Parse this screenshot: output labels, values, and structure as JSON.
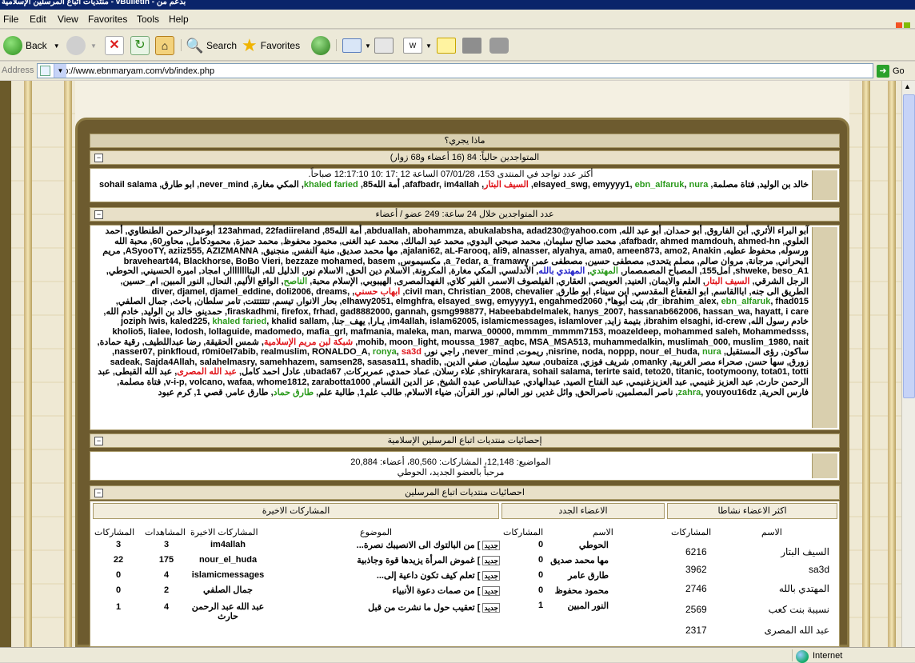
{
  "window": {
    "title": "منتديات اتباع المرسلين الإسلامية - vBulletin - بدعم من"
  },
  "menu": [
    "File",
    "Edit",
    "View",
    "Favorites",
    "Tools",
    "Help"
  ],
  "toolbar": {
    "back": "Back",
    "search": "Search",
    "favorites": "Favorites"
  },
  "address": {
    "label": "Address",
    "url": "http://www.ebnmaryam.com/vb/index.php",
    "go": "Go"
  },
  "whats_going_on": "ماذا يجري؟",
  "online": {
    "header": "المتواجدين حالياً: 84 (16 أعضاء و68 زوار)",
    "record": "أكثر عدد تواجد في المنتدى 153، 07/01/28 الساعة 12 :17 :10 12:17:10 صباحاً.",
    "users_html": "<span>خالد بن الوليد, فتاة مصلمة, elsayed_swg, </span><span>emyyyy1, </span><span class='g'>ebn_alfaruk</span>, <span class='g'>nura</span>, <span class='r'>السيف البتار</span>, afafbadr, im4allah, أمة الله85, <span class='g'>khaled faried</span>, المكي مغارة, never_mind, ابو طارق, sohail salama"
  },
  "last24": {
    "header": "عدد المتواجدين خلال 24 ساعة: 249 عضو / أعضاء",
    "users_html": "<span>آبو البراء الأثري, أبن الفاروق, أبو حمدان, أبو عبد الله, abduallah, abohammza, abukalabsha, adad230@yahoo.com, أمة الله85, 123ahmad, 22fadiireland</span> أبوعبدالرحمن الطنطاوي, أحمد العلوي, afafbadr, ahmed mamdouh, ahmed-hn, محمد صالح سليمان, محمد صبحي البدوي, محمد عبد المالك, محمد عبد الغنى, محمود محفوظ, محمد حمزة, محمودكامل, محاور60, محبة الله ورسوله, محفوظ عطيه, ajalani62, aL-Farooq, ali9, alnasser, alyahya, ama0, ameen873, amo2, Anakin, مها محمد صديق, منية النفس, منجنيق, ASyooTY, aziiz555, AZIZMANNA, مريم البحراني, مرجانة, مروان صالم, مصلم يتحدى, مصطفى حسين, مصطفى عمر, a_7edar, a_framawy, مكسيموس, braveheart44, Blackhorse, BoBo Vieri, bezzaze mohamed, basem shweke, beso_A1, امل155, المصباح المصمصمار, <span class='g'>المهتدي</span>, <span class='b'>المهتدي بالله</span>, الأندلسي, المكي مغارة, المكرونة, الاسلام دين الحق, الاسلام نور, الذليل لله, البتاااااااار, امجاد, اميره الحسيني, الحوطي, الرجل الشرقي, <span class='r'>السيف البتار</span>, العلم والايمان, العنيد, العويصي, العقاري, الفيلصوف الاسمر, الفير كلاي, الفهدالمصرى, الهيبوبي, الإسلام محبة, <span class='g'>الناصح</span>, الواقع الأليم, النحال, النور المبين, ام_حسين, الطريق الى جنه, اباالقاسم, ابو القعقاع المقدسي, ابن سيناء, ابو طارق, civil man, Christian_2008, chevalier, <span class='r'>ابهاب حسني</span>, diver, djamel, djamel_eddine, doli2006, dreams, dr_ibrahim_alex, <span class='g'>ebn_alfaruk</span>, fhad015, بنت أبوها*, elhawy2051, elmghfra, elsayed_swg, emyyyy1, engahmed2060, بحار الانوار, تيسم, تتتتتتت, تامر سلطان, باحث, جمال الصلفي, firaskadhmi, firefox, frhad, gad8882000, gannah, gsmg998877, Habeebabdelmalek, hanys_2007, hassanab662006, hassan_wa, hayatt, i care, حمدينو, خالد بن الوليد, خادم الله, خادم رسول الله, ibrahim elsaghi, id-crew, بتيمة زايد, im4allah, islam62005, islamicmessages, islamlover, يـارا, يهف_جنا, joziph lwis, kaled225, <span class='g'>khaled faried</span>, khalid sallam, kholio5, lialee, lodosh, lollaguide, madomedo, mafia_grl, mafmania, maleka, man, marwa_00000, mmmm_mmmm7153, moazeldeep, mohammed saleh, Mohammedsss, mohib, moon_light, moussa_1987_aqbc, MSA_MSA513, muhammedalkin, muslimah_000, muslim_1980, nait, <span class='r'>شبكة لبن مريم الإسلامية</span>, شمس الحقيقة, رضا عبداللطيف, رقية حمادة, ساكون, رؤى المستقبل, nisrine, noda, noppp, nour_el_huda, <span class='g'>nura</span>, ريموت, never_mind, راجي نور, nasser07, pinkfloud, r0mi0el7abib, realmuslim, RONALDO_A, <span class='g'>ronya</span>, <span class='r'>sa3d</span>, زورق, سها حسن, صحراء مصر الغربية, omanky, شريف فوزي, oubaiza, سعيد سليمان, صفي الدين, sadeak, Sajda4Allah, salahelmasry, samehhazem, samsen28, sasasa11, shadib, shirykarara, sohail salama, terirte said, teto20, titanic, tootymoony, tota01, totti, علاء رسلان, عماد حمدي, عمربركات, ubada67, عادل احمد كامل, <span class='r'>عبد الله المصرى</span>, عبد الله القبطى, عبد الرحمن حارث, عبد العزيز غنيمي, عبد العزيزغنيمي, عبد الفتاح الصيد, عبدالهادي, عبدالناصر, عبده الشيخ, عز الدين القسام, v-i-p, volcano, wafaa, whome1812, zarabotta1000, فتاة مصلمة, فارس الحرية, <span class='g'>zahra</span>, youyou16dz, ناصر المصلمين, ناصرالحق, وائل غدير, نور العالم, نور القرآن, ضياء الاسلام, طالب علم1, طالبة علم, <span class='g'>طارق حماد</span>, طارق عامر, قصي 1, كرم عبود"
  },
  "stats_header": "إحصائيات منتديات اتباع المرسلين الإسلامية",
  "stats": {
    "line1": "المواضيع: 12,148، المشاركات: 80,560، أعضاء: 20,884",
    "line2": "مرحباً بالعضو الجديد، الحوطي"
  },
  "stats_panel": {
    "header": "احصائيات منتديات اتباع المرسلين",
    "most_active": {
      "title": "اكثر الاعضاء نشاطا",
      "col_name": "الاسم",
      "col_posts": "المشاركات",
      "rows": [
        [
          "السيف البتار",
          "6216"
        ],
        [
          "sa3d",
          "3962"
        ],
        [
          "المهتدي بالله",
          "2746"
        ],
        [
          "نسيبة بنت كعب",
          "2569"
        ],
        [
          "عبد الله المصرى",
          "2317"
        ]
      ]
    },
    "new_members": {
      "title": "الاعضاء الجدد",
      "col_name": "الاسم",
      "col_posts": "المشاركات",
      "rows": [
        [
          "الحوطي",
          "0"
        ],
        [
          "مها محمد صديق",
          "0"
        ],
        [
          "طارق عامر",
          "0"
        ],
        [
          "محمود محفوظ",
          "0"
        ],
        [
          "النور المبين",
          "1"
        ]
      ]
    },
    "latest_posts": {
      "title": "المشاركات الاخيرة",
      "col_topic": "الموضوع",
      "col_last": "المشاركات الاخيرة",
      "col_views": "المشاهدات",
      "col_posts": "المشاركات",
      "new_tag": "جديد",
      "rows": [
        [
          "من البالتوك الى الانصيبك نصرة...",
          "im4allah",
          "3",
          "3"
        ],
        [
          "غموض المرأة يزيدها قوة وجاذبية",
          "nour_el_huda",
          "175",
          "22"
        ],
        [
          "تعلم كيف تكون داعية إلى...",
          "islamicmessages",
          "4",
          "0"
        ],
        [
          "من صمات دعوة الأنبياء",
          "جمال الصلفي",
          "2",
          "0"
        ],
        [
          "تعقيب حول ما نشرت من قبل",
          "عبد الله عبد الرحمن حارث",
          "4",
          "1"
        ]
      ]
    }
  },
  "status": {
    "zone": "Internet"
  }
}
